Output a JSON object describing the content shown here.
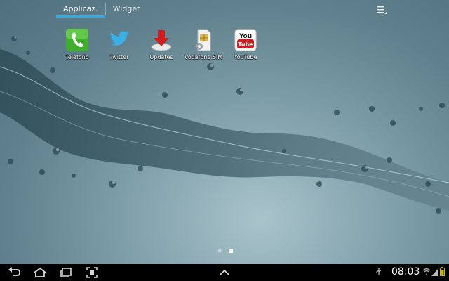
{
  "tabs": [
    {
      "label": "Applicaz.",
      "active": true
    },
    {
      "label": "Widget",
      "active": false
    }
  ],
  "apps": [
    {
      "label": "Telefono",
      "icon": "phone-icon"
    },
    {
      "label": "Twitter",
      "icon": "twitter-bird-icon"
    },
    {
      "label": "Updates",
      "icon": "download-arrow-icon"
    },
    {
      "label": "Vodafone SIM",
      "icon": "sim-card-icon"
    },
    {
      "label": "YouTube",
      "icon": "youtube-icon"
    }
  ],
  "page_indicator": {
    "pages": 2,
    "current": 2
  },
  "status_bar": {
    "time": "08:03",
    "icons": [
      "usb-icon",
      "wifi-icon",
      "signal-icon",
      "battery-icon"
    ]
  },
  "colors": {
    "accent": "#3aa8dc",
    "navbar": "#000000",
    "wallpaper": "#7e9ea9"
  }
}
